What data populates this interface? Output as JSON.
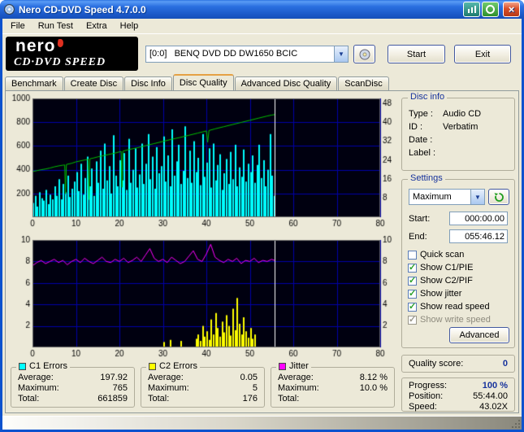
{
  "window": {
    "title": "Nero CD-DVD Speed 4.7.0.0"
  },
  "menu": {
    "items": [
      "File",
      "Run Test",
      "Extra",
      "Help"
    ]
  },
  "header": {
    "logo_line1": "nero",
    "logo_line2": "CD·DVD SPEED",
    "drive_select": "[0:0]   BENQ DVD DD DW1650 BCIC",
    "start_label": "Start",
    "exit_label": "Exit"
  },
  "tabs": {
    "items": [
      "Benchmark",
      "Create Disc",
      "Disc Info",
      "Disc Quality",
      "Advanced Disc Quality",
      "ScanDisc"
    ],
    "active": "Disc Quality"
  },
  "disc_info": {
    "title": "Disc info",
    "rows": [
      [
        "Type :",
        "Audio CD"
      ],
      [
        "ID :",
        "Verbatim"
      ],
      [
        "Date :",
        ""
      ],
      [
        "Label :",
        ""
      ]
    ]
  },
  "settings": {
    "title": "Settings",
    "speed_select": "Maximum",
    "start_label": "Start:",
    "start_value": "000:00.00",
    "end_label": "End:",
    "end_value": "055:46.12",
    "checkboxes": [
      {
        "label": "Quick scan",
        "checked": false,
        "disabled": false
      },
      {
        "label": "Show C1/PIE",
        "checked": true,
        "disabled": false
      },
      {
        "label": "Show C2/PIF",
        "checked": true,
        "disabled": false
      },
      {
        "label": "Show jitter",
        "checked": true,
        "disabled": false
      },
      {
        "label": "Show read speed",
        "checked": true,
        "disabled": false
      },
      {
        "label": "Show write speed",
        "checked": true,
        "disabled": true
      }
    ],
    "advanced_label": "Advanced"
  },
  "quality": {
    "label": "Quality score:",
    "value": "0"
  },
  "progress": {
    "rows": [
      [
        "Progress:",
        "100 %"
      ],
      [
        "Position:",
        "55:44.00"
      ],
      [
        "Speed:",
        "43.02X"
      ]
    ]
  },
  "legend": {
    "boxes": [
      {
        "title": "C1 Errors",
        "color": "#00ffff",
        "rows": [
          [
            "Average:",
            "197.92"
          ],
          [
            "Maximum:",
            "765"
          ],
          [
            "Total:",
            "661859"
          ]
        ]
      },
      {
        "title": "C2 Errors",
        "color": "#ffff00",
        "rows": [
          [
            "Average:",
            "0.05"
          ],
          [
            "Maximum:",
            "5"
          ],
          [
            "Total:",
            "176"
          ]
        ]
      },
      {
        "title": "Jitter",
        "color": "#ff00ff",
        "rows": [
          [
            "Average:",
            "8.12 %"
          ],
          [
            "Maximum:",
            "10.0 %"
          ],
          [
            "Total:",
            ""
          ]
        ]
      }
    ]
  },
  "chart_data": [
    {
      "type": "bar+line",
      "title": "C1 errors / read speed",
      "x_range": [
        0,
        80
      ],
      "x_ticks": [
        0,
        10,
        20,
        30,
        40,
        50,
        60,
        70,
        80
      ],
      "left_axis": {
        "label": "C1 errors",
        "range": [
          0,
          1000
        ],
        "ticks": [
          200,
          400,
          600,
          800,
          1000
        ]
      },
      "right_axis": {
        "label": "read speed X",
        "range": [
          0,
          50
        ],
        "ticks": [
          8,
          16,
          24,
          32,
          40,
          48
        ]
      },
      "bg": "#000010",
      "grid_color": "#0000a8",
      "marker_color": "#ffffff",
      "marker_x": 55.7,
      "series": [
        {
          "name": "C1 errors",
          "type": "bar",
          "color": "#00ffff",
          "start_x": 0,
          "x_step": 0.5,
          "values": [
            120,
            180,
            90,
            210,
            160,
            140,
            230,
            110,
            190,
            150,
            260,
            180,
            320,
            150,
            280,
            210,
            350,
            170,
            240,
            300,
            380,
            220,
            450,
            190,
            330,
            510,
            260,
            410,
            180,
            470,
            290,
            560,
            240,
            620,
            310,
            430,
            200,
            690,
            350,
            260,
            480,
            310,
            540,
            230,
            660,
            290,
            400,
            580,
            250,
            360,
            620,
            280,
            450,
            700,
            320,
            510,
            240,
            590,
            370,
            430,
            680,
            300,
            520,
            260,
            740,
            350,
            470,
            610,
            280,
            390,
            765,
            330,
            560,
            290,
            640,
            380,
            500,
            270,
            700,
            340,
            460,
            580,
            250,
            620,
            310,
            440,
            530,
            230,
            370,
            490,
            280,
            550,
            320,
            610,
            260,
            420,
            340,
            570,
            300,
            450,
            380,
            520,
            290,
            440,
            610,
            330,
            480,
            260,
            400,
            700,
            350,
            180
          ]
        },
        {
          "name": "Read speed",
          "type": "line",
          "color": "#00c000",
          "axis": "right",
          "points": [
            [
              0,
              19.2
            ],
            [
              1,
              19.6
            ],
            [
              2,
              20.0
            ],
            [
              3,
              20.3
            ],
            [
              4,
              20.7
            ],
            [
              5,
              21.2
            ],
            [
              6,
              21.6
            ],
            [
              7,
              21.9
            ],
            [
              7.4,
              22.0
            ],
            [
              7.6,
              9.8
            ],
            [
              7.8,
              22.2
            ],
            [
              9,
              22.7
            ],
            [
              10,
              23.3
            ],
            [
              11,
              23.7
            ],
            [
              12,
              24.1
            ],
            [
              12.8,
              24.4
            ],
            [
              13,
              7.4
            ],
            [
              13.2,
              24.6
            ],
            [
              14,
              24.9
            ],
            [
              15,
              25.4
            ],
            [
              16,
              25.8
            ],
            [
              17,
              26.2
            ],
            [
              18,
              26.6
            ],
            [
              19,
              27.0
            ],
            [
              20,
              27.5
            ],
            [
              20.4,
              27.7
            ],
            [
              20.6,
              12.6
            ],
            [
              20.8,
              27.8
            ],
            [
              22,
              28.4
            ],
            [
              24,
              29.2
            ],
            [
              26,
              30.1
            ],
            [
              28,
              31.0
            ],
            [
              30,
              31.9
            ],
            [
              32,
              32.8
            ],
            [
              34,
              33.6
            ],
            [
              36,
              34.5
            ],
            [
              38,
              35.4
            ],
            [
              40,
              36.3
            ],
            [
              40.3,
              31.5
            ],
            [
              40.6,
              36.5
            ],
            [
              42,
              37.2
            ],
            [
              44,
              38.1
            ],
            [
              46,
              39.0
            ],
            [
              48,
              39.9
            ],
            [
              50,
              40.8
            ],
            [
              52,
              41.7
            ],
            [
              54,
              42.6
            ],
            [
              55,
              43.0
            ],
            [
              55.7,
              43.2
            ]
          ]
        }
      ]
    },
    {
      "type": "bar+line",
      "title": "C2 errors / jitter",
      "x_range": [
        0,
        80
      ],
      "x_ticks": [
        0,
        10,
        20,
        30,
        40,
        50,
        60,
        70,
        80
      ],
      "left_axis": {
        "label": "C2 errors",
        "range": [
          0,
          10
        ],
        "ticks": [
          2,
          4,
          6,
          8,
          10
        ]
      },
      "right_axis": {
        "label": "jitter %",
        "range": [
          0,
          10
        ],
        "ticks": [
          2,
          4,
          6,
          8,
          10
        ]
      },
      "bg": "#000010",
      "grid_color": "#0000a8",
      "marker_color": "#ffffff",
      "marker_x": 55.7,
      "series": [
        {
          "name": "C2 errors",
          "type": "bar",
          "color": "#ffff00",
          "points": [
            [
              30,
              0.5
            ],
            [
              31.5,
              0.7
            ],
            [
              34,
              0.6
            ],
            [
              37.5,
              0.8
            ],
            [
              38,
              1.2
            ],
            [
              38.5,
              0.6
            ],
            [
              39,
              2.0
            ],
            [
              39.5,
              1.0
            ],
            [
              40,
              1.5
            ],
            [
              40.5,
              0.7
            ],
            [
              41,
              2.6
            ],
            [
              41.5,
              1.2
            ],
            [
              42,
              3.2
            ],
            [
              42.5,
              1.8
            ],
            [
              43,
              1.0
            ],
            [
              43.5,
              2.4
            ],
            [
              44,
              1.4
            ],
            [
              44.5,
              3.0
            ],
            [
              45,
              2.0
            ],
            [
              45.5,
              1.1
            ],
            [
              46,
              3.6
            ],
            [
              46.5,
              1.6
            ],
            [
              47,
              4.6
            ],
            [
              47.5,
              2.2
            ],
            [
              48,
              1.2
            ],
            [
              48.5,
              2.8
            ],
            [
              49,
              1.5
            ],
            [
              49.5,
              0.9
            ],
            [
              50,
              1.8
            ],
            [
              50.5,
              0.8
            ],
            [
              51,
              1.2
            ]
          ]
        },
        {
          "name": "Jitter",
          "type": "line",
          "color": "#ff00ff",
          "axis": "left",
          "points": [
            [
              0,
              7.6
            ],
            [
              1,
              7.9
            ],
            [
              2,
              8.1
            ],
            [
              3,
              7.8
            ],
            [
              4,
              8.0
            ],
            [
              5,
              8.2
            ],
            [
              6,
              7.9
            ],
            [
              7,
              8.1
            ],
            [
              8,
              7.7
            ],
            [
              9,
              8.0
            ],
            [
              10,
              8.2
            ],
            [
              11,
              7.9
            ],
            [
              12,
              8.3
            ],
            [
              13,
              8.0
            ],
            [
              14,
              7.8
            ],
            [
              15,
              8.1
            ],
            [
              16,
              8.4
            ],
            [
              17,
              8.0
            ],
            [
              18,
              7.9
            ],
            [
              19,
              8.2
            ],
            [
              20,
              8.0
            ],
            [
              21,
              8.3
            ],
            [
              22,
              7.9
            ],
            [
              23,
              8.1
            ],
            [
              24,
              8.4
            ],
            [
              25,
              8.0
            ],
            [
              26,
              8.6
            ],
            [
              27,
              9.2
            ],
            [
              28,
              8.3
            ],
            [
              29,
              8.0
            ],
            [
              30,
              8.2
            ],
            [
              31,
              7.9
            ],
            [
              32,
              8.4
            ],
            [
              33,
              8.1
            ],
            [
              34,
              7.8
            ],
            [
              35,
              8.0
            ],
            [
              36,
              8.5
            ],
            [
              37,
              9.0
            ],
            [
              38,
              8.2
            ],
            [
              39,
              8.0
            ],
            [
              40,
              8.7
            ],
            [
              41,
              9.6
            ],
            [
              42,
              8.4
            ],
            [
              43,
              8.1
            ],
            [
              44,
              7.9
            ],
            [
              45,
              8.2
            ],
            [
              46,
              8.0
            ],
            [
              47,
              8.3
            ],
            [
              48,
              7.8
            ],
            [
              49,
              8.1
            ],
            [
              50,
              8.0
            ],
            [
              51,
              8.3
            ],
            [
              52,
              7.9
            ],
            [
              53,
              8.1
            ],
            [
              54,
              8.0
            ],
            [
              55,
              8.2
            ],
            [
              55.7,
              8.1
            ]
          ]
        }
      ]
    }
  ]
}
